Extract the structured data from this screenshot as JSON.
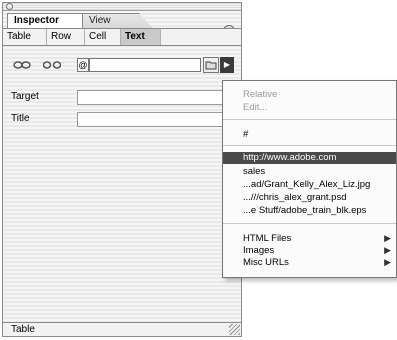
{
  "tabs": [
    {
      "label": "Inspector"
    },
    {
      "label": "View"
    }
  ],
  "subtabs": [
    {
      "label": "Table"
    },
    {
      "label": "Row"
    },
    {
      "label": "Cell"
    },
    {
      "label": "Text"
    }
  ],
  "toolbar": {
    "anchor_symbol": "@",
    "url_value": "",
    "arrow_glyph": "▶",
    "collapse_glyph": "▸"
  },
  "fields": {
    "target_label": "Target",
    "title_label": "Title"
  },
  "status_text": "Table",
  "menu": {
    "items": [
      {
        "label": "Relative",
        "disabled": true
      },
      {
        "label": "Edit...",
        "disabled": true
      },
      {
        "label": "#",
        "disabled": false
      },
      {
        "label": "http://www.adobe.com",
        "selected": true
      },
      {
        "label": "sales"
      },
      {
        "label": "...ad/Grant_Kelly_Alex_Liz.jpg"
      },
      {
        "label": "...///chris_alex_grant.psd"
      },
      {
        "label": "...e Stuff/adobe_train_blk.eps"
      },
      {
        "label": "HTML Files",
        "submenu": "▶"
      },
      {
        "label": "Images",
        "submenu": "▶"
      },
      {
        "label": "Misc URLs",
        "submenu": "▶"
      }
    ]
  }
}
